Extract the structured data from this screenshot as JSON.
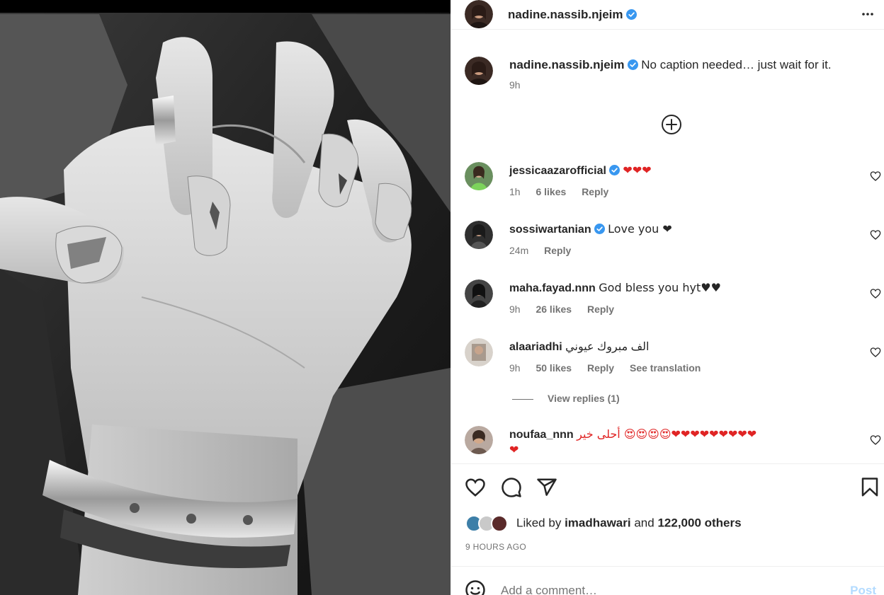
{
  "post": {
    "author": "nadine.nassib.njeim",
    "caption_text": "No caption needed… just wait for it.",
    "caption_time": "9h",
    "time_ago": "9 HOURS AGO"
  },
  "comments": [
    {
      "user": "jessicaazarofficial",
      "verified": true,
      "text": "❤❤❤",
      "time": "1h",
      "likes": "6 likes",
      "reply": "Reply"
    },
    {
      "user": "sossiwartanian",
      "verified": true,
      "text": "Love you ❤",
      "time": "24m",
      "reply": "Reply"
    },
    {
      "user": "maha.fayad.nnn",
      "verified": false,
      "text": "God bless you hyt♥♥",
      "time": "9h",
      "likes": "26 likes",
      "reply": "Reply"
    },
    {
      "user": "alaariadhi",
      "verified": false,
      "text": "الف مبروك عيوني",
      "time": "9h",
      "likes": "50 likes",
      "reply": "Reply",
      "translate": "See translation"
    },
    {
      "user": "noufaa_nnn",
      "verified": false,
      "text": "أحلى خير 😍😍😍😍❤❤❤❤❤❤❤❤❤",
      "text_line2": "❤"
    }
  ],
  "view_replies": "View replies (1)",
  "likes": {
    "prefix": "Liked by",
    "user": "imadhawari",
    "and": "and",
    "others": "122,000 others"
  },
  "add_comment": {
    "placeholder": "Add a comment…",
    "post_label": "Post"
  },
  "icons": {
    "more": "more-options-icon",
    "verified": "verified-badge-icon",
    "load_more": "load-more-comments-icon",
    "like": "heart-icon",
    "comment": "comment-icon",
    "share": "share-icon",
    "save": "bookmark-icon",
    "emoji": "emoji-icon"
  },
  "colors": {
    "verified": "#3897f0",
    "heart": "#e02424",
    "post_button": "#b3dbff",
    "secondary_text": "#737373"
  }
}
